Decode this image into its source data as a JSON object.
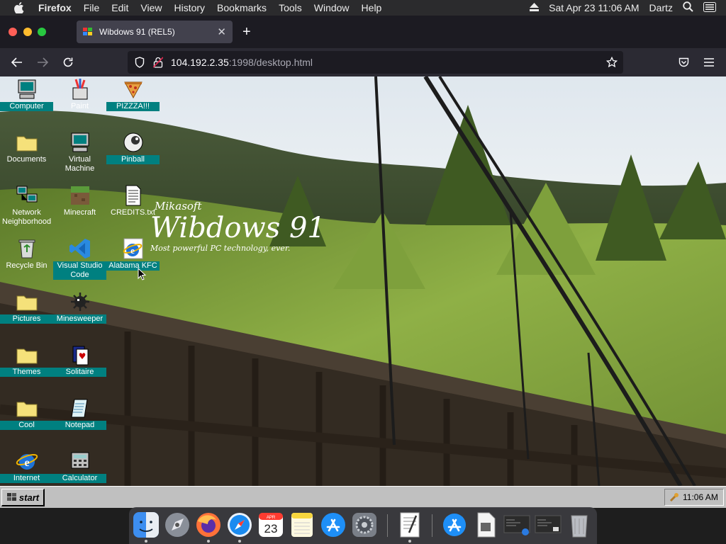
{
  "menubar": {
    "items": [
      "Firefox",
      "File",
      "Edit",
      "View",
      "History",
      "Bookmarks",
      "Tools",
      "Window",
      "Help"
    ],
    "clock": "Sat Apr 23  11:06 AM",
    "user": "Dartz"
  },
  "browser": {
    "tab_title": "Wibdows 91 (REL5)",
    "url_host": "104.192.2.35",
    "url_path": ":1998/desktop.html"
  },
  "desktop": {
    "icons": [
      {
        "label": "Computer",
        "icon": "computer-icon"
      },
      {
        "label": "Paint",
        "icon": "paint-icon"
      },
      {
        "label": "PIZZZA!!!",
        "icon": "pizza-icon"
      },
      {
        "label": "Documents",
        "icon": "folder-icon"
      },
      {
        "label": "Virtual Machine",
        "icon": "computer-icon"
      },
      {
        "label": "Pinball",
        "icon": "pinball-icon"
      },
      {
        "label": "Network Neighborhood",
        "icon": "network-icon"
      },
      {
        "label": "Minecraft",
        "icon": "minecraft-icon"
      },
      {
        "label": "CREDITS.txt",
        "icon": "text-file-icon"
      },
      {
        "label": "Recycle Bin",
        "icon": "recycle-bin-icon"
      },
      {
        "label": "Visual Studio Code",
        "icon": "vscode-icon"
      },
      {
        "label": "Alabama KFC",
        "icon": "internet-explorer-icon"
      },
      {
        "label": "Pictures",
        "icon": "folder-icon"
      },
      {
        "label": "Minesweeper",
        "icon": "mine-icon"
      },
      {
        "label": "Themes",
        "icon": "folder-icon"
      },
      {
        "label": "Solitaire",
        "icon": "cards-icon"
      },
      {
        "label": "Cool",
        "icon": "folder-icon"
      },
      {
        "label": "Notepad",
        "icon": "notepad-icon"
      },
      {
        "label": "Internet",
        "icon": "internet-explorer-icon"
      },
      {
        "label": "Calculator",
        "icon": "calculator-icon"
      }
    ],
    "brand": {
      "company": "Mikasoft",
      "product": "Wibdows 91",
      "tagline": "Most powerful PC technology, ever."
    }
  },
  "taskbar": {
    "start_label": "start",
    "time": "11:06 AM"
  },
  "dock": {
    "calendar_month": "APR",
    "calendar_day": "23",
    "apps": [
      "finder-icon",
      "launchpad-icon",
      "firefox-icon",
      "safari-icon",
      "calendar-icon",
      "notes-icon",
      "app-store-icon",
      "system-preferences-icon",
      "textedit-icon",
      "app-store-downloads-icon",
      "preview-icon",
      "screenshot-window-icon",
      "screenshot-window-icon",
      "trash-icon"
    ]
  }
}
